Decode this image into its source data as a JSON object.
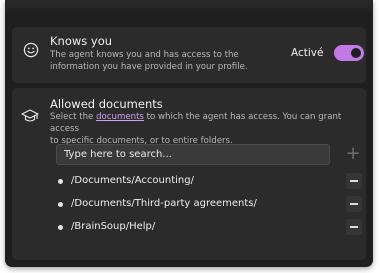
{
  "knows_you": {
    "title": "Knows you",
    "description_line1": "The agent knows you and has access to the",
    "description_line2": "information you have provided in your profile.",
    "status_label": "Activé",
    "enabled": true,
    "icon": "smiley-face-icon"
  },
  "allowed_documents": {
    "title": "Allowed documents",
    "description_pre": "Select the ",
    "description_link": "documents",
    "description_post": " to which the agent has access. You can grant access",
    "description_line2": "to specific documents, or to entire folders.",
    "icon": "graduation-cap-icon",
    "search_placeholder": "Type here to search...",
    "add_icon": "plus-icon",
    "remove_icon": "minus-icon",
    "items": [
      {
        "path": "/Documents/Accounting/"
      },
      {
        "path": "/Documents/Third-party agreements/"
      },
      {
        "path": "/BrainSoup/Help/"
      }
    ]
  },
  "colors": {
    "accent": "#c079e6",
    "link": "#d2a0f2",
    "panel": "#2b2b2b",
    "background": "#1f1f1f"
  }
}
